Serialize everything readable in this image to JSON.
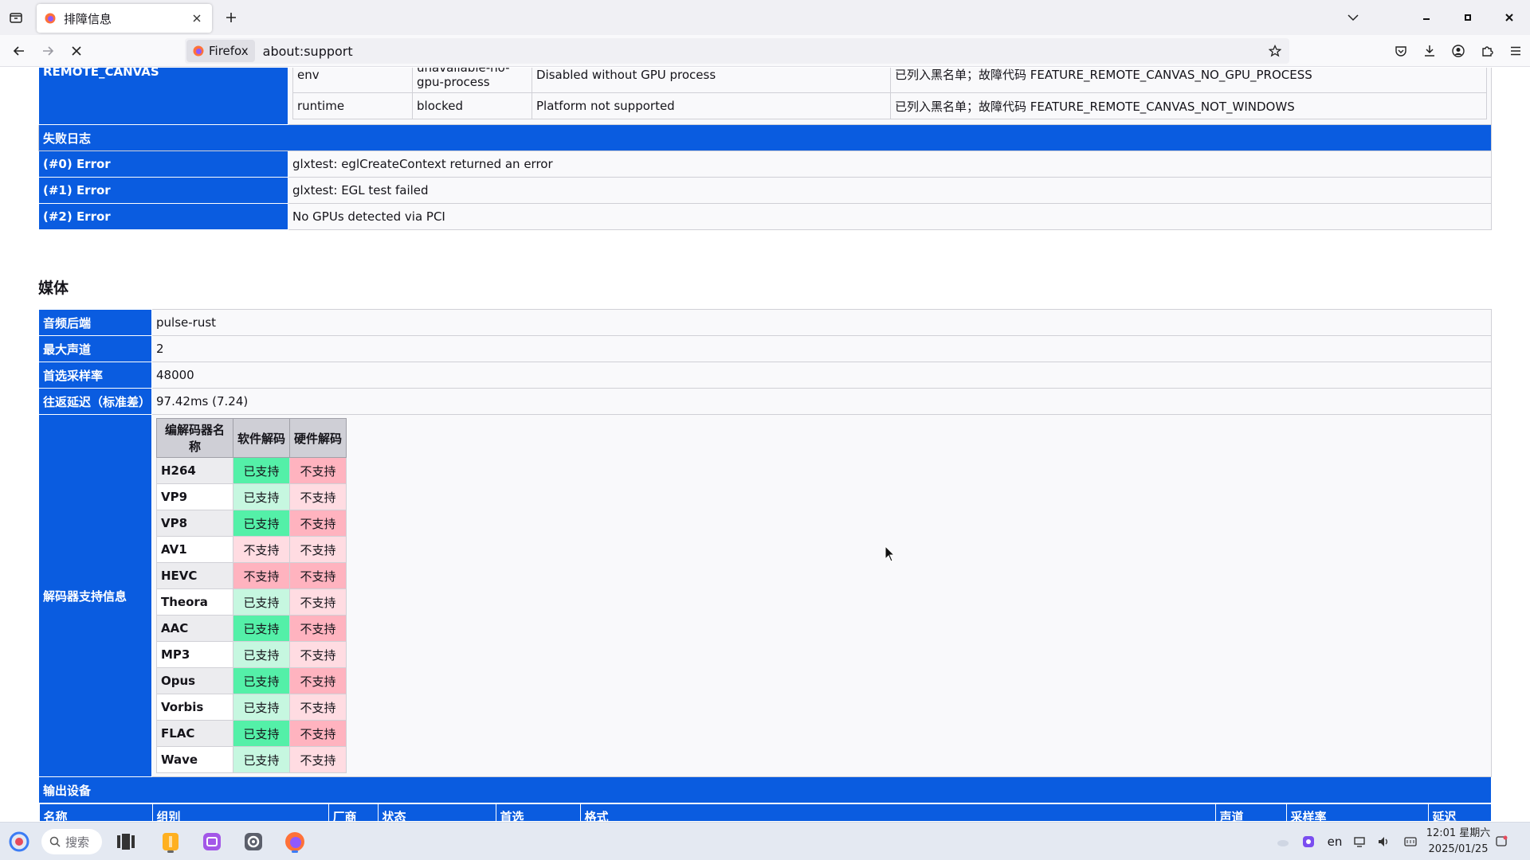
{
  "browser": {
    "tab_title": "排障信息",
    "identity_label": "Firefox",
    "url": "about:support"
  },
  "gfx": {
    "remote_canvas_label": "REMOTE_CANVAS",
    "rows": [
      {
        "source": "env",
        "status": "unavailable-no-gpu-process",
        "message": "Disabled without GPU process",
        "failure": "已列入黑名单；故障代码 FEATURE_REMOTE_CANVAS_NO_GPU_PROCESS"
      },
      {
        "source": "runtime",
        "status": "blocked",
        "message": "Platform not supported",
        "failure": "已列入黑名单；故障代码 FEATURE_REMOTE_CANVAS_NOT_WINDOWS"
      }
    ],
    "failure_log_title": "失败日志",
    "errors": [
      {
        "label": "(#0) Error",
        "value": "glxtest: eglCreateContext returned an error"
      },
      {
        "label": "(#1) Error",
        "value": "glxtest: EGL test failed"
      },
      {
        "label": "(#2) Error",
        "value": "No GPUs detected via PCI"
      }
    ]
  },
  "media": {
    "title": "媒体",
    "rows": [
      {
        "label": "音频后端",
        "value": "pulse-rust"
      },
      {
        "label": "最大声道",
        "value": "2"
      },
      {
        "label": "首选采样率",
        "value": "48000"
      },
      {
        "label": "往返延迟（标准差）",
        "value": "97.42ms (7.24)"
      }
    ],
    "decoder_label": "解码器支持信息",
    "codec_headers": [
      "编解码器名称",
      "软件解码",
      "硬件解码"
    ],
    "codecs": [
      {
        "name": "H264",
        "sw": "已支持",
        "hw": "不支持"
      },
      {
        "name": "VP9",
        "sw": "已支持",
        "hw": "不支持"
      },
      {
        "name": "VP8",
        "sw": "已支持",
        "hw": "不支持"
      },
      {
        "name": "AV1",
        "sw": "不支持",
        "hw": "不支持"
      },
      {
        "name": "HEVC",
        "sw": "不支持",
        "hw": "不支持"
      },
      {
        "name": "Theora",
        "sw": "已支持",
        "hw": "不支持"
      },
      {
        "name": "AAC",
        "sw": "已支持",
        "hw": "不支持"
      },
      {
        "name": "MP3",
        "sw": "已支持",
        "hw": "不支持"
      },
      {
        "name": "Opus",
        "sw": "已支持",
        "hw": "不支持"
      },
      {
        "name": "Vorbis",
        "sw": "已支持",
        "hw": "不支持"
      },
      {
        "name": "FLAC",
        "sw": "已支持",
        "hw": "不支持"
      },
      {
        "name": "Wave",
        "sw": "已支持",
        "hw": "不支持"
      }
    ],
    "output_devices_title": "输出设备",
    "output_columns": [
      "名称",
      "组别",
      "厂商",
      "状态",
      "首选",
      "格式",
      "声道",
      "采样率",
      "延迟"
    ]
  },
  "taskbar": {
    "search_placeholder": "搜索",
    "lang": "en",
    "time": "12:01 星期六",
    "date": "2025/01/25"
  },
  "colors": {
    "accent_blue": "#0a5ce0",
    "supported_green": "#54f0a8",
    "unsupported_red": "#ffb3bf"
  }
}
